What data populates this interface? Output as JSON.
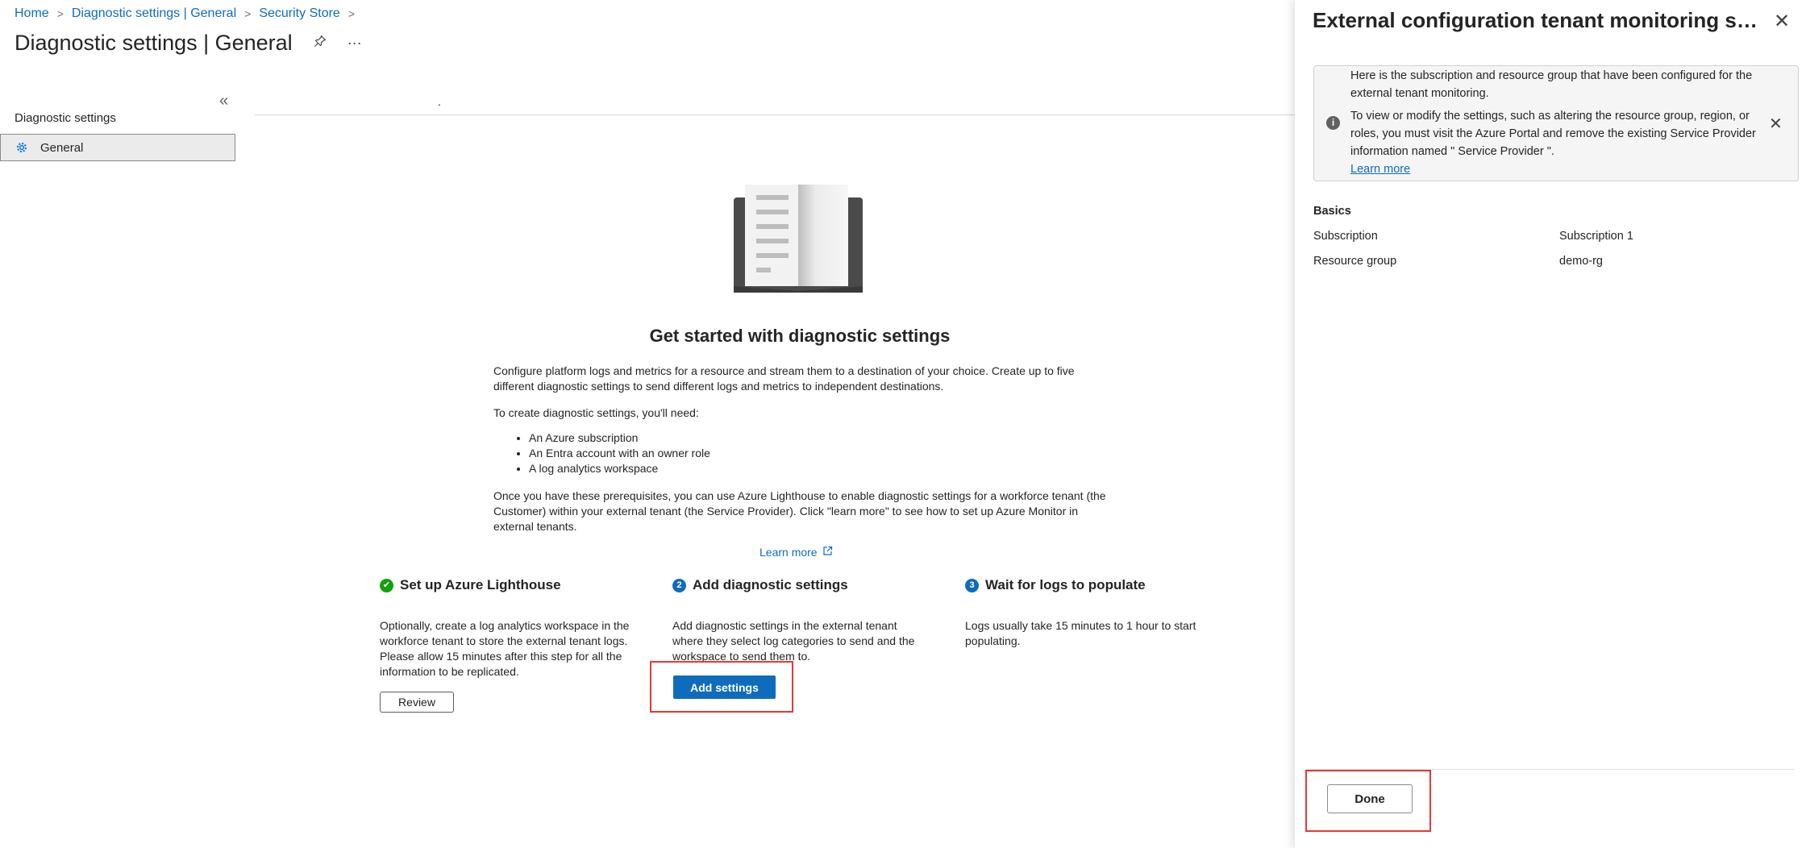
{
  "breadcrumb": {
    "items": [
      "Home",
      "Diagnostic settings | General",
      "Security Store"
    ],
    "separator": ">"
  },
  "page": {
    "title": "Diagnostic settings | General",
    "pin_icon": "pin-icon",
    "more_label": "···"
  },
  "nav": {
    "collapse_label": "«",
    "heading": "Diagnostic settings",
    "items": [
      {
        "label": "General",
        "icon": "gear-icon"
      }
    ]
  },
  "main": {
    "dot": ".",
    "heading": "Get started with diagnostic settings",
    "intro": "Configure platform logs and metrics for a resource and stream them to a destination of your choice. Create up to five different diagnostic settings to send different logs and metrics to independent destinations.",
    "need_label": "To create diagnostic settings, you'll need:",
    "prerequisites": [
      "An Azure subscription",
      "An Entra account with an owner role",
      "A log analytics workspace"
    ],
    "outro": "Once you have these prerequisites, you can use Azure Lighthouse to enable diagnostic settings for a workforce tenant (the Customer) within your external tenant (the Service Provider). Click \"learn more\" to see how to set up Azure Monitor in external tenants.",
    "learn_more": "Learn more",
    "steps": [
      {
        "badge": "✔",
        "title": "Set up Azure Lighthouse",
        "text": "Optionally, create a log analytics workspace in the workforce tenant to store the external tenant logs. Please allow 15 minutes after this step for all the information to be replicated.",
        "button": "Review",
        "badge_color": "#13a10e"
      },
      {
        "badge": "2",
        "title": "Add diagnostic settings",
        "text": "Add diagnostic settings in the external tenant where they select log categories to send and the workspace to send them to.",
        "button": "Add settings",
        "badge_color": "#0f6cbd"
      },
      {
        "badge": "3",
        "title": "Wait for logs to populate",
        "text": "Logs usually take 15 minutes to 1 hour to start populating.",
        "badge_color": "#0f6cbd"
      }
    ]
  },
  "panel": {
    "title": "External configuration tenant monitoring se...",
    "close_label": "✕",
    "info": {
      "line1": "Here is the subscription and resource group that have been configured for the external tenant monitoring.",
      "line2": "To view or modify the settings, such as altering the resource group, region, or roles, you must visit the Azure Portal and remove the existing Service Provider information named \" Service Provider \".",
      "link": "Learn more",
      "dismiss_label": "✕"
    },
    "basics_heading": "Basics",
    "fields": [
      {
        "key": "Subscription",
        "value": "Subscription 1"
      },
      {
        "key": "Resource group",
        "value": "demo-rg"
      }
    ],
    "done_label": "Done"
  },
  "colors": {
    "accent": "#0f6cbd",
    "highlight": "#e53935",
    "success": "#13a10e"
  }
}
